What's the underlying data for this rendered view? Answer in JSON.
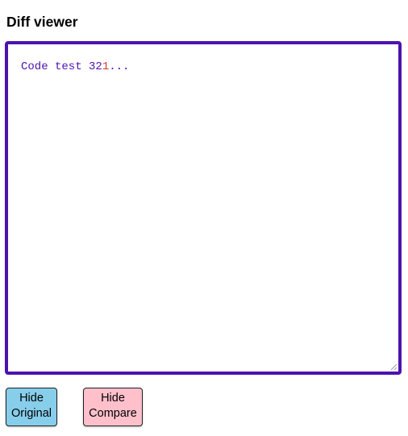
{
  "page": {
    "title": "Diff viewer"
  },
  "editor": {
    "segments": [
      {
        "text": "Code test 32",
        "status": "same"
      },
      {
        "text": "1",
        "status": "changed"
      },
      {
        "text": "...",
        "status": "same"
      }
    ],
    "colors": {
      "border": "#4C12B0",
      "same_text": "#4C12B0",
      "changed_text": "#E0322F"
    }
  },
  "buttons": {
    "hide_original": {
      "line1": "Hide",
      "line2": "Original",
      "color": "#87CEEB"
    },
    "hide_compare": {
      "line1": "Hide",
      "line2": "Compare",
      "color": "#FFC0CB"
    }
  }
}
